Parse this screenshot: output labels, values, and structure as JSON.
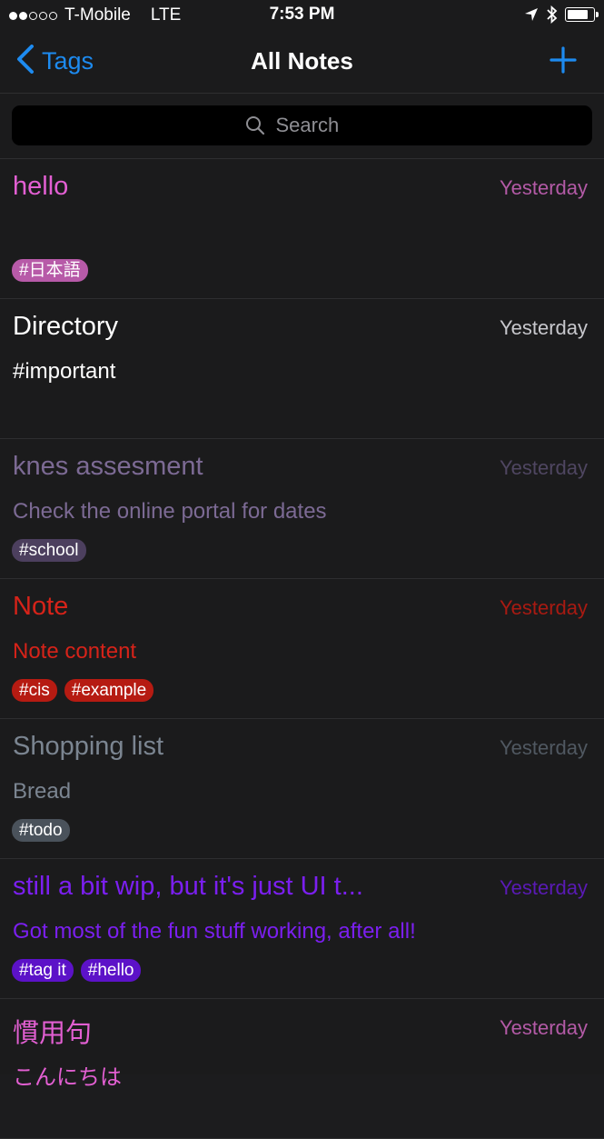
{
  "status_bar": {
    "signal_full": 2,
    "signal_empty": 3,
    "carrier": "T-Mobile",
    "network": "LTE",
    "time": "7:53 PM",
    "battery_level": 0.8
  },
  "nav": {
    "back_label": "Tags",
    "title": "All Notes"
  },
  "search": {
    "placeholder": "Search"
  },
  "notes": [
    {
      "title": "hello",
      "date": "Yesterday",
      "body": "",
      "tags": [
        "#日本語"
      ],
      "color": "#e25fd2",
      "date_color": "#b35aa6",
      "body_color": "#e25fd2",
      "tag_bg": "#b75aa8"
    },
    {
      "title": "Directory",
      "date": "Yesterday",
      "body": "#important",
      "tags": [],
      "color": "#ffffff",
      "date_color": "#c7c7cc",
      "body_color": "#ffffff",
      "tag_bg": "#555555"
    },
    {
      "title": "knes assesment",
      "date": "Yesterday",
      "body": "Check the online portal for dates",
      "tags": [
        "#school"
      ],
      "color": "#7c6a94",
      "date_color": "#4f4661",
      "body_color": "#7c6a94",
      "tag_bg": "#4c3f5e"
    },
    {
      "title": "Note",
      "date": "Yesterday",
      "body": " Note content",
      "tags": [
        "#cis",
        "#example"
      ],
      "color": "#d62319",
      "date_color": "#a81a12",
      "body_color": "#d62319",
      "tag_bg": "#b61b12"
    },
    {
      "title": "Shopping list",
      "date": "Yesterday",
      "body": "Bread",
      "tags": [
        "#todo"
      ],
      "color": "#7b8591",
      "date_color": "#505861",
      "body_color": "#7b8591",
      "tag_bg": "#4a525b"
    },
    {
      "title": "still a bit wip, but it's just UI t...",
      "date": "Yesterday",
      "body": "Got most of the fun stuff working, after all!",
      "tags": [
        "#tag it",
        "#hello"
      ],
      "color": "#7b1ff0",
      "date_color": "#5a1ab5",
      "body_color": "#7b1ff0",
      "tag_bg": "#5c12c8"
    },
    {
      "title": "慣用句",
      "date": "Yesterday",
      "body": "こんにちは",
      "tags": [],
      "color": "#e25fd2",
      "date_color": "#b35aa6",
      "body_color": "#e25fd2",
      "tag_bg": "#b75aa8"
    }
  ]
}
